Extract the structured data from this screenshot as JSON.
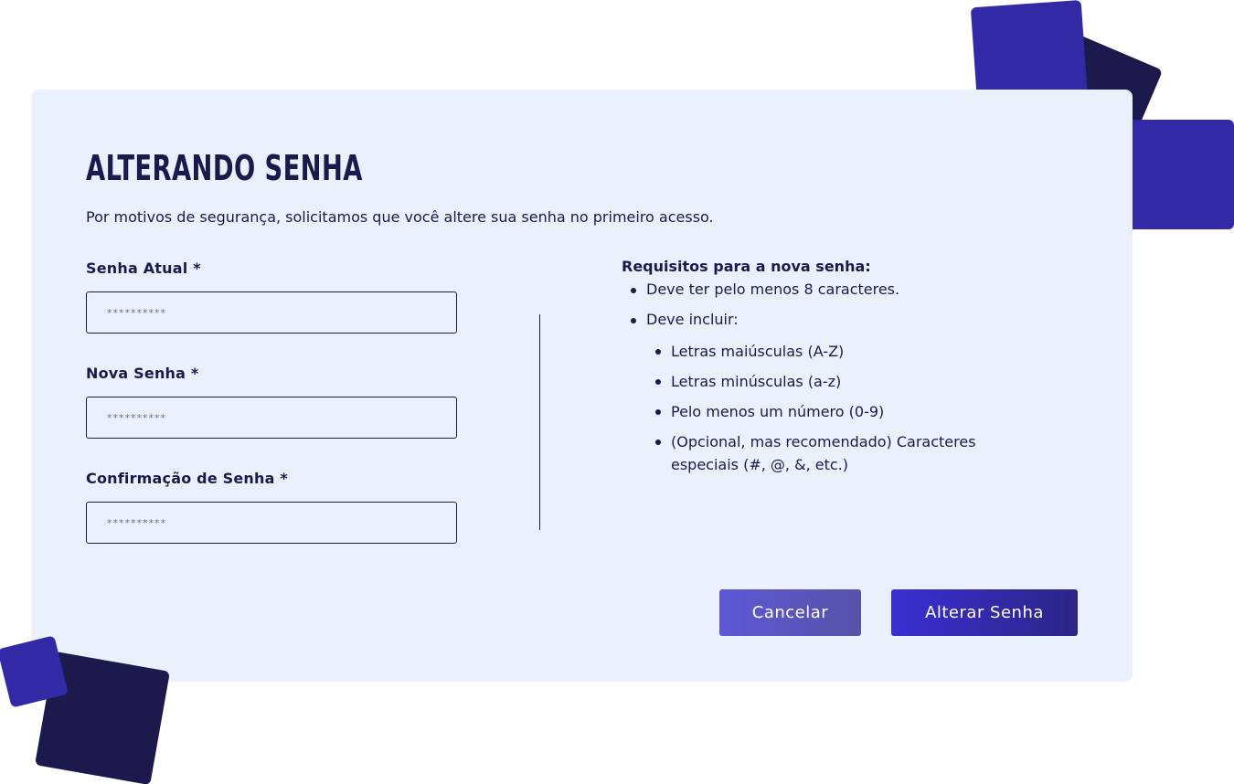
{
  "header": {
    "title": "ALTERANDO SENHA",
    "subtitle": "Por motivos de segurança, solicitamos que você altere sua senha no primeiro acesso."
  },
  "form": {
    "current_password": {
      "label": "Senha Atual *",
      "placeholder": "**********"
    },
    "new_password": {
      "label": "Nova Senha *",
      "placeholder": "**********"
    },
    "confirm_password": {
      "label": "Confirmação de Senha *",
      "placeholder": "**********"
    }
  },
  "requirements": {
    "title": "Requisitos para a nova senha:",
    "items": [
      "Deve ter pelo menos 8 caracteres.",
      "Deve incluir:"
    ],
    "sub_items": [
      "Letras maiúsculas (A-Z)",
      "Letras minúsculas (a-z)",
      "Pelo menos um número (0-9)",
      "(Opcional, mas recomendado) Caracteres especiais (#, @, &, etc.)"
    ]
  },
  "actions": {
    "cancel_label": "Cancelar",
    "submit_label": "Alterar Senha"
  },
  "colors": {
    "primary": "#3a2ed3",
    "dark": "#1c1a4c",
    "card_bg": "#eaf0fc",
    "deco_blue": "#3229a6"
  }
}
